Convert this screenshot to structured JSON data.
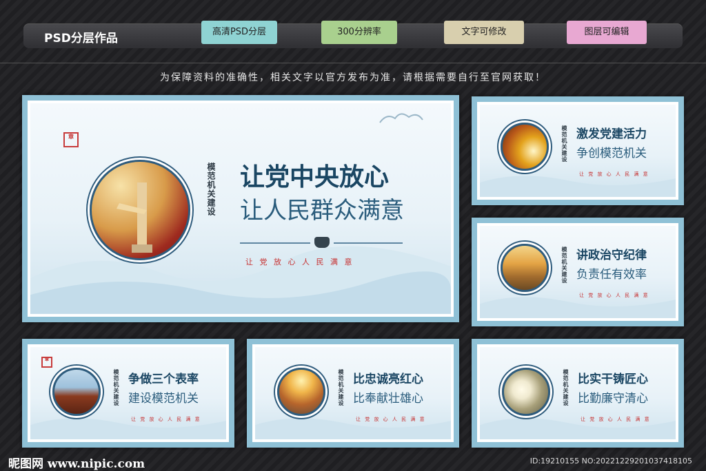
{
  "header": {
    "title": "PSD分层作品",
    "tags": [
      {
        "label": "高清PSD分层",
        "color": "#8fd3d3"
      },
      {
        "label": "300分辨率",
        "color": "#a9d08e"
      },
      {
        "label": "文字可修改",
        "color": "#d8cfae"
      },
      {
        "label": "图层可编辑",
        "color": "#e8a8d2"
      }
    ]
  },
  "notice": "为保障资料的准确性，相关文字以官方发布为准，请根据需要自行至官网获取！",
  "boards": {
    "main": {
      "vertical": "模范机关建设",
      "line1": "让党中央放心",
      "line2": "让人民群众满意",
      "slogan": "让 党 放 心   人 民 满 意"
    },
    "b1": {
      "vertical": "模范机关建设",
      "line1": "激发党建活力",
      "line2": "争创模范机关",
      "slogan": "让 党 放 心   人 民 满 意"
    },
    "b2": {
      "vertical": "模范机关建设",
      "line1": "讲政治守纪律",
      "line2": "负责任有效率",
      "slogan": "让 党 放 心   人 民 满 意"
    },
    "b3": {
      "vertical": "模范机关建设",
      "line1": "争做三个表率",
      "line2": "建设模范机关",
      "slogan": "让 党 放 心   人 民 满 意"
    },
    "b4": {
      "vertical": "模范机关建设",
      "line1": "比忠诚亮红心",
      "line2": "比奉献壮雄心",
      "slogan": "让 党 放 心   人 民 满 意"
    },
    "b5": {
      "vertical": "模范机关建设",
      "line1": "比实干铸匠心",
      "line2": "比勤廉守清心",
      "slogan": "让 党 放 心   人 民 满 意"
    }
  },
  "footer": {
    "logo": "昵图网 www.nipic.com",
    "id": "ID:19210155 NO:20221229201037418105"
  }
}
